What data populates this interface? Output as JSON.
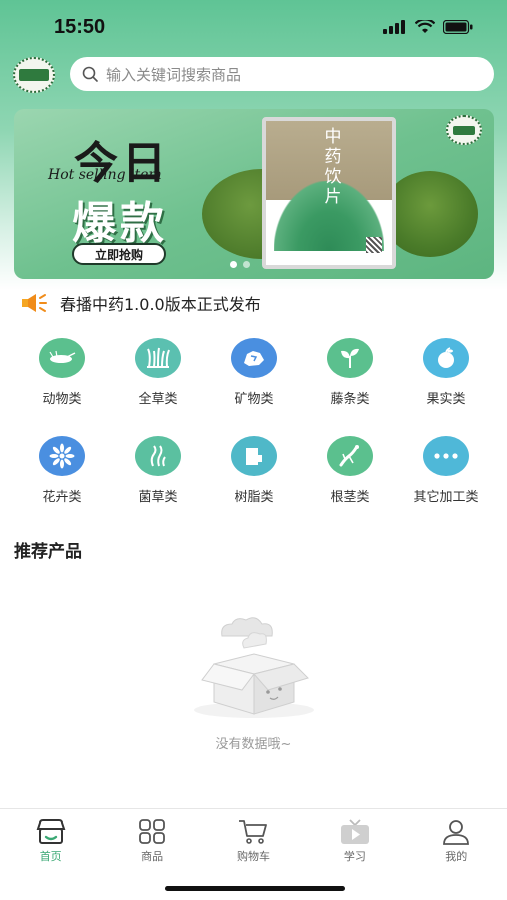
{
  "status": {
    "time": "15:50"
  },
  "search": {
    "placeholder": "输入关键词搜索商品"
  },
  "banner": {
    "title_line1": "今日",
    "title_line2": "爆款",
    "subtitle": "Hot selling item",
    "button_label": "立即抢购",
    "package_label": "中药饮片"
  },
  "notice": {
    "text": "春播中药1.0.0版本正式发布"
  },
  "categories": [
    {
      "label": "动物类",
      "icon": "animal-icon",
      "color": "#5bc08e"
    },
    {
      "label": "全草类",
      "icon": "grass-icon",
      "color": "#5bc0b0"
    },
    {
      "label": "矿物类",
      "icon": "mineral-icon",
      "color": "#4a8fe0"
    },
    {
      "label": "藤条类",
      "icon": "sprout-icon",
      "color": "#5bc08e"
    },
    {
      "label": "果实类",
      "icon": "fruit-icon",
      "color": "#4fb8e0"
    },
    {
      "label": "花卉类",
      "icon": "flower-icon",
      "color": "#4a8fe0"
    },
    {
      "label": "菌草类",
      "icon": "seaweed-icon",
      "color": "#5bc0a0"
    },
    {
      "label": "树脂类",
      "icon": "resin-icon",
      "color": "#4fb8c8"
    },
    {
      "label": "根茎类",
      "icon": "ginseng-icon",
      "color": "#5bc08e"
    },
    {
      "label": "其它加工类",
      "icon": "more-icon",
      "color": "#4fb8d8"
    }
  ],
  "recommend": {
    "title": "推荐产品",
    "empty_text": "没有数据哦~"
  },
  "tabbar": [
    {
      "label": "首页",
      "icon": "home-icon",
      "active": true
    },
    {
      "label": "商品",
      "icon": "grid-icon",
      "active": false
    },
    {
      "label": "购物车",
      "icon": "cart-icon",
      "active": false
    },
    {
      "label": "学习",
      "icon": "video-icon",
      "active": false
    },
    {
      "label": "我的",
      "icon": "user-icon",
      "active": false
    }
  ],
  "colors": {
    "accent": "#3aa874",
    "header": "#5fc495"
  }
}
